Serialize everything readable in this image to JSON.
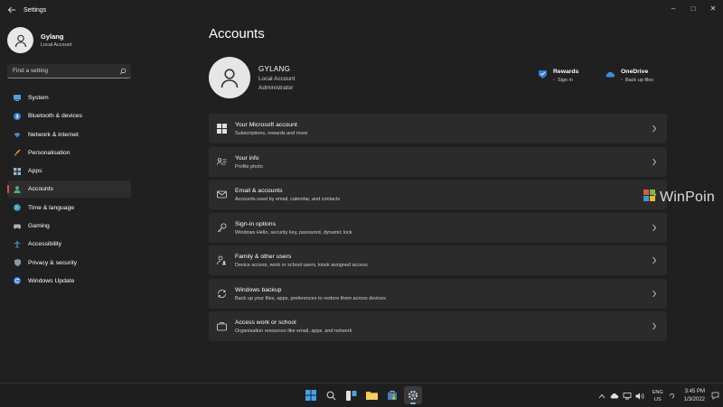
{
  "titlebar": {
    "app_title": "Settings",
    "minimize": "–",
    "maximize": "□",
    "close": "✕"
  },
  "sidebar": {
    "profile_name": "Gylang",
    "profile_sub": "Local Account",
    "search_placeholder": "Find a setting",
    "items": [
      {
        "label": "System",
        "icon": "system-icon"
      },
      {
        "label": "Bluetooth & devices",
        "icon": "bluetooth-icon"
      },
      {
        "label": "Network & internet",
        "icon": "wifi-icon"
      },
      {
        "label": "Personalisation",
        "icon": "brush-icon"
      },
      {
        "label": "Apps",
        "icon": "apps-icon"
      },
      {
        "label": "Accounts",
        "icon": "person-icon",
        "active": true
      },
      {
        "label": "Time & language",
        "icon": "globe-icon"
      },
      {
        "label": "Gaming",
        "icon": "gamepad-icon"
      },
      {
        "label": "Accessibility",
        "icon": "accessibility-icon"
      },
      {
        "label": "Privacy & security",
        "icon": "shield-icon"
      },
      {
        "label": "Windows Update",
        "icon": "update-icon"
      }
    ]
  },
  "main": {
    "title": "Accounts",
    "account": {
      "name": "GYLANG",
      "type": "Local Account",
      "role": "Administrator"
    },
    "tiles": [
      {
        "title": "Rewards",
        "sub": "Sign in"
      },
      {
        "title": "OneDrive",
        "sub": "Back up files"
      }
    ],
    "cards": [
      {
        "title": "Your Microsoft account",
        "sub": "Subscriptions, rewards and more"
      },
      {
        "title": "Your info",
        "sub": "Profile photo"
      },
      {
        "title": "Email & accounts",
        "sub": "Accounts used by email, calendar, and contacts"
      },
      {
        "title": "Sign-in options",
        "sub": "Windows Hello, security key, password, dynamic lock"
      },
      {
        "title": "Family & other users",
        "sub": "Device access, work or school users, kiosk assigned access"
      },
      {
        "title": "Windows backup",
        "sub": "Back up your files, apps, preferences to restore them across devices"
      },
      {
        "title": "Access work or school",
        "sub": "Organisation resources like email, apps, and network"
      }
    ]
  },
  "watermark": "WinPoin",
  "taskbar": {
    "lang_line1": "ENG",
    "lang_line2": "US",
    "time": "3:45 PM",
    "date": "1/3/2022"
  },
  "colors": {
    "accent": "#e04a5a",
    "background": "#202020",
    "card": "#2b2b2b"
  }
}
